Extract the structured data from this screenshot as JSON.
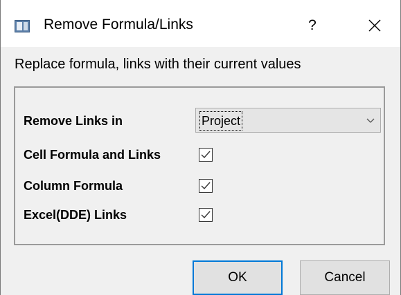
{
  "window": {
    "title": "Remove Formula/Links",
    "help_label": "?",
    "close_icon": "close-icon",
    "app_icon": "dialog-app-icon"
  },
  "dialog": {
    "description": "Replace formula, links with their current values",
    "remove_links_label": "Remove Links in",
    "remove_links_value": "Project",
    "options": [
      {
        "label": "Cell Formula and Links",
        "checked": true
      },
      {
        "label": "Column Formula",
        "checked": true
      },
      {
        "label": "Excel(DDE) Links",
        "checked": true
      }
    ]
  },
  "buttons": {
    "ok_label": "OK",
    "cancel_label": "Cancel"
  },
  "colors": {
    "accent": "#0078d7",
    "background": "#f0f0f0"
  }
}
